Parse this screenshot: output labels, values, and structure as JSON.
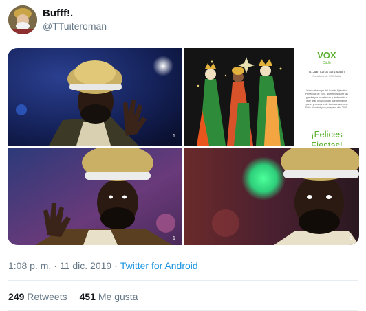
{
  "tweet": {
    "display_name": "Bufff!.",
    "handle": "@TTuiteroman",
    "time": "1:08 p. m.",
    "date": "11 dic. 2019",
    "separator": "·",
    "source": "Twitter for Android",
    "retweets_count": "249",
    "retweets_label": "Retweets",
    "likes_count": "451",
    "likes_label": "Me gusta"
  },
  "media": {
    "watermark": "1",
    "vox": {
      "logo": "VOX",
      "region": "Cádiz",
      "person": "D. Juan Carlos Sanz Martín",
      "role": "Presidente de VOX Cádiz",
      "message_lines": [
        "Y todo el equipo del Comité Ejecutivo",
        "Provincial de VOX, queremos darte las",
        "gracias por tu esfuerzo y dedicación a",
        "este gran proyecto del que formamos",
        "parte, y desearte de todo corazón una",
        "Feliz Navidad y un próspero año 2020."
      ],
      "greeting": "¡Felices",
      "greeting_cut": "Fiestas!"
    },
    "colors": {
      "vox_green": "#5bb130",
      "link_blue": "#1b95e0"
    }
  }
}
